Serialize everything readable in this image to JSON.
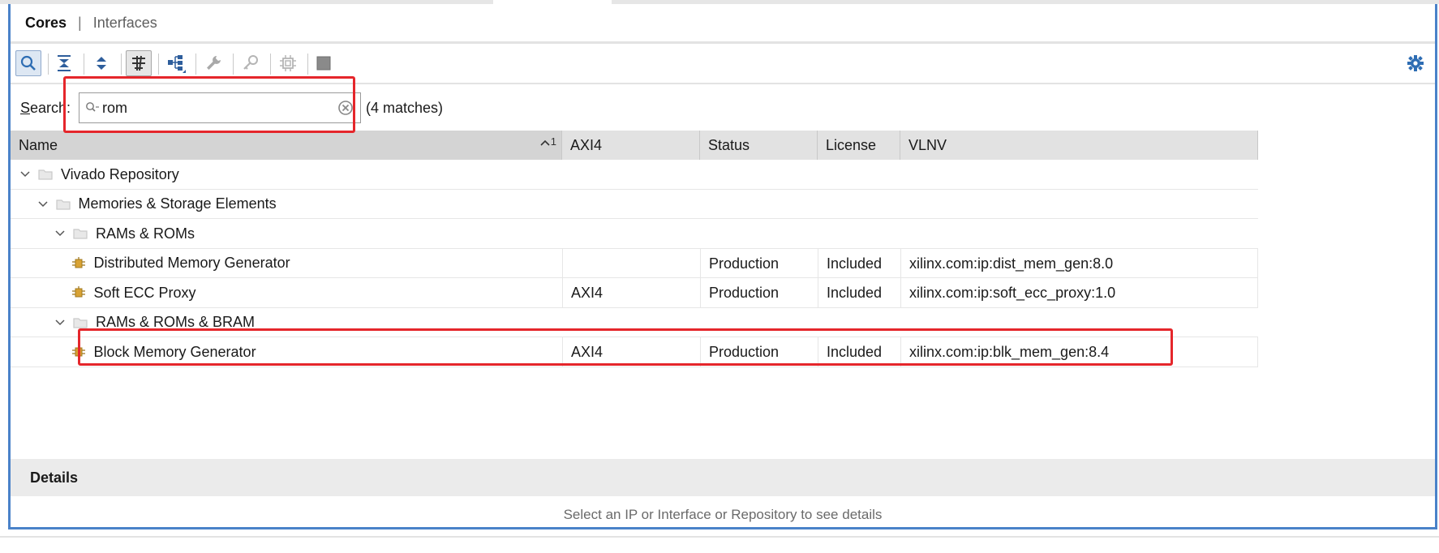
{
  "tabs": [
    {
      "label": "Cores",
      "active": true
    },
    {
      "label": "Interfaces",
      "active": false
    }
  ],
  "toolbar": {
    "buttons": [
      {
        "icon": "search-icon",
        "state": "pressed"
      },
      {
        "icon": "collapse-all-icon",
        "state": "normal"
      },
      {
        "icon": "expand-all-icon",
        "state": "normal"
      },
      {
        "icon": "filter-icon",
        "state": "toggled"
      },
      {
        "icon": "hierarchy-icon",
        "state": "normal"
      },
      {
        "icon": "wrench-icon",
        "state": "disabled"
      },
      {
        "icon": "key-icon",
        "state": "disabled"
      },
      {
        "icon": "chip-icon",
        "state": "disabled"
      },
      {
        "icon": "square-icon",
        "state": "disabled"
      }
    ],
    "settings_icon": "gear-icon"
  },
  "search": {
    "label_prefix": "S",
    "label_rest": "earch:",
    "value": "rom",
    "matches": "(4 matches)"
  },
  "table": {
    "columns": [
      "Name",
      "AXI4",
      "Status",
      "License",
      "VLNV"
    ],
    "sort_index": "1",
    "rows": [
      {
        "level": 0,
        "type": "folder",
        "name": "Vivado Repository",
        "axi": "",
        "status": "",
        "license": "",
        "vlnv": ""
      },
      {
        "level": 1,
        "type": "folder",
        "name": "Memories & Storage Elements",
        "axi": "",
        "status": "",
        "license": "",
        "vlnv": ""
      },
      {
        "level": 2,
        "type": "folder",
        "name": "RAMs & ROMs",
        "axi": "",
        "status": "",
        "license": "",
        "vlnv": ""
      },
      {
        "level": 3,
        "type": "ip",
        "name": "Distributed Memory Generator",
        "axi": "",
        "status": "Production",
        "license": "Included",
        "vlnv": "xilinx.com:ip:dist_mem_gen:8.0"
      },
      {
        "level": 3,
        "type": "ip",
        "name": "Soft ECC Proxy",
        "axi": "AXI4",
        "status": "Production",
        "license": "Included",
        "vlnv": "xilinx.com:ip:soft_ecc_proxy:1.0"
      },
      {
        "level": 2,
        "type": "folder",
        "name": "RAMs & ROMs & BRAM",
        "axi": "",
        "status": "",
        "license": "",
        "vlnv": ""
      },
      {
        "level": 3,
        "type": "ip",
        "name": "Block Memory Generator",
        "axi": "AXI4",
        "status": "Production",
        "license": "Included",
        "vlnv": "xilinx.com:ip:blk_mem_gen:8.4"
      }
    ]
  },
  "details": {
    "title": "Details",
    "message": "Select an IP or Interface or Repository to see details"
  },
  "colors": {
    "frame_border": "#4a82c9",
    "highlight": "#e5262b",
    "folder": "#c9c9c9",
    "ip_icon": "#d9a233"
  }
}
